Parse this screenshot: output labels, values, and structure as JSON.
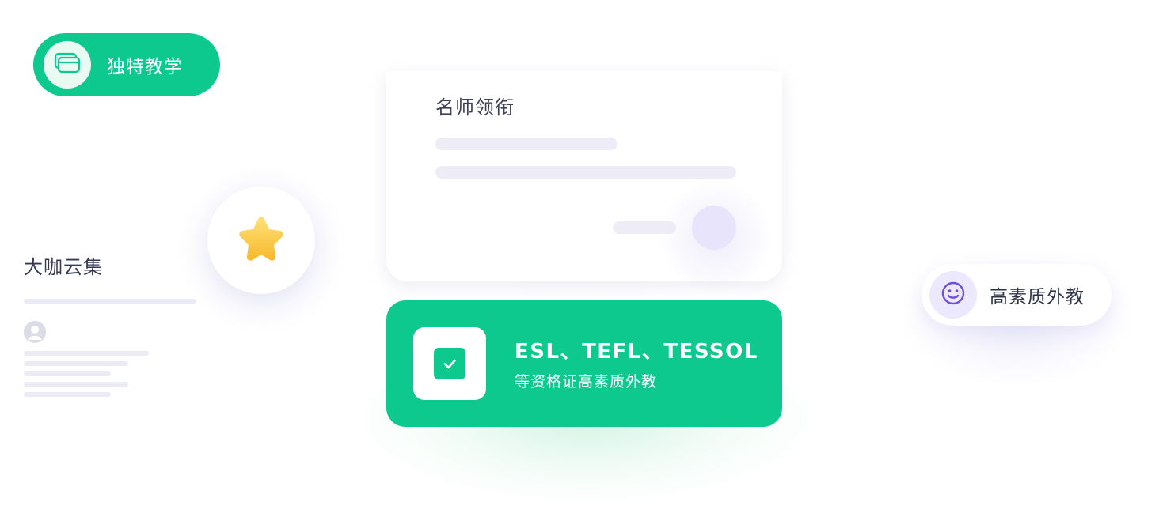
{
  "top_pill": {
    "label": "独特教学",
    "icon": "cards-stack-icon",
    "color": "#0ec98d"
  },
  "left_panel": {
    "title": "大咖云集",
    "avatar_icon": "user-avatar-icon"
  },
  "star_badge": {
    "icon": "star-icon"
  },
  "teacher_card": {
    "title": "名师领衔"
  },
  "certificate_card": {
    "title": "ESL、TEFL、TESSOL",
    "subtitle": "等资格证高素质外教",
    "icon": "checkbox-icon",
    "color": "#0ec98d"
  },
  "right_pill": {
    "label": "高素质外教",
    "icon": "smile-icon",
    "accent": "#6b4fe0"
  }
}
